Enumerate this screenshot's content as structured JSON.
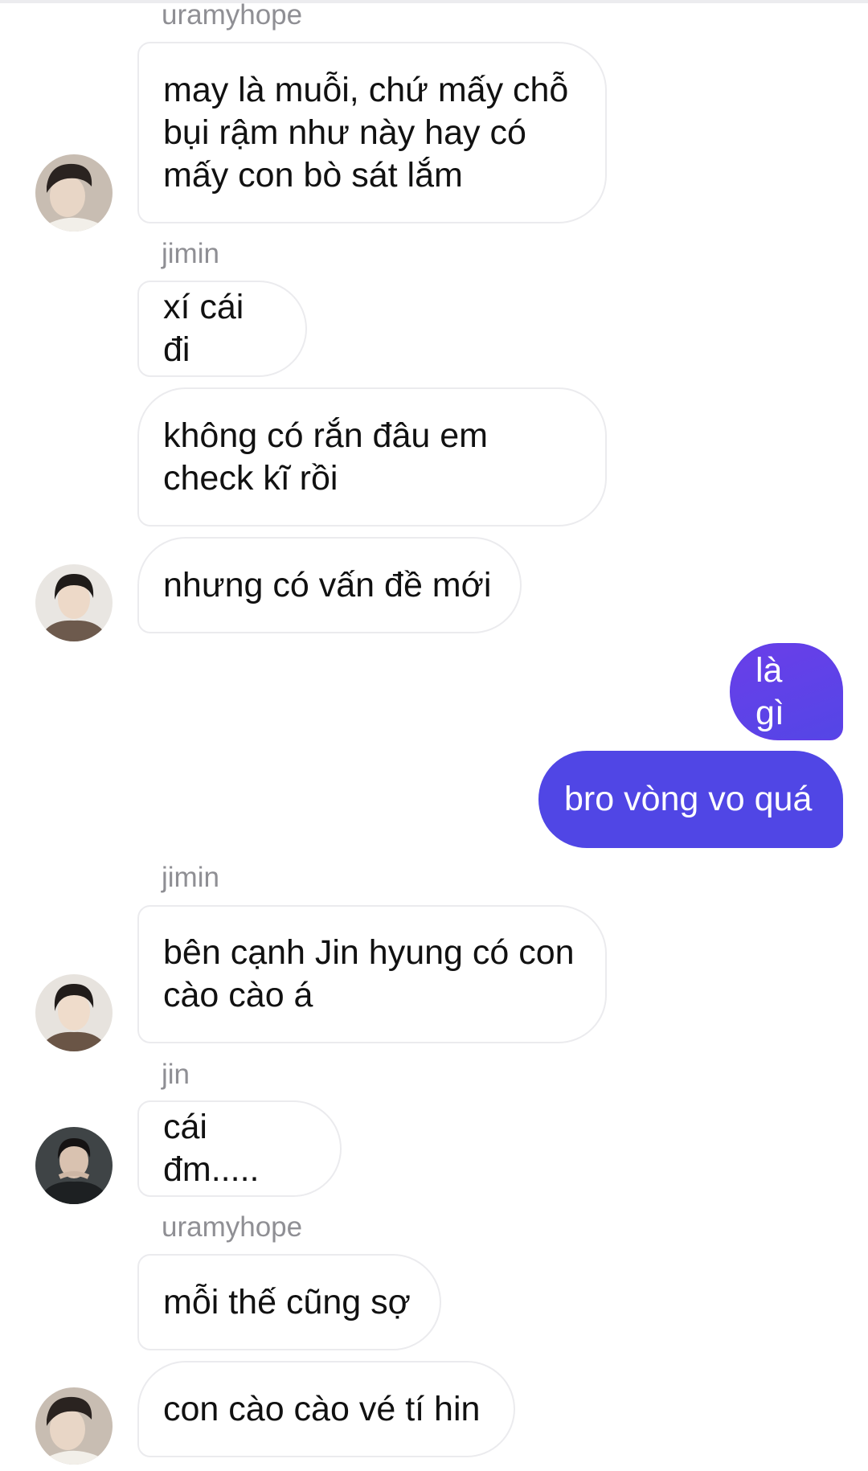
{
  "chat": {
    "messages": [
      {
        "sender": "uramyhope",
        "text": "may là muỗi, chứ mấy chỗ bụi rậm như này hay có mấy con bò sát lắm"
      },
      {
        "sender": "jimin",
        "text": "xí cái đi"
      },
      {
        "text": "không có rắn đâu em check kĩ rồi"
      },
      {
        "text": "nhưng có vấn đề mới"
      },
      {
        "outgoing": true,
        "text": "là gì"
      },
      {
        "outgoing": true,
        "text": "bro vòng vo quá"
      },
      {
        "sender": "jimin",
        "text": "bên cạnh Jin hyung có con cào cào á"
      },
      {
        "sender": "jin",
        "text": "cái đm....."
      },
      {
        "sender": "uramyhope",
        "text": "mỗi thế cũng sợ"
      },
      {
        "text": "con cào cào vé tí hin"
      }
    ],
    "avatars": [
      {
        "user": "uramyhope",
        "icon": "avatar-icon"
      },
      {
        "user": "jimin",
        "icon": "avatar-icon"
      },
      {
        "user": "jimin",
        "icon": "avatar-icon"
      },
      {
        "user": "jin",
        "icon": "avatar-icon"
      },
      {
        "user": "uramyhope",
        "icon": "avatar-icon"
      }
    ],
    "colors": {
      "outgoing_bubble": "#5046e5",
      "incoming_bubble": "#ffffff",
      "incoming_border": "#ebebee",
      "sender_name": "#8f8f94"
    }
  }
}
